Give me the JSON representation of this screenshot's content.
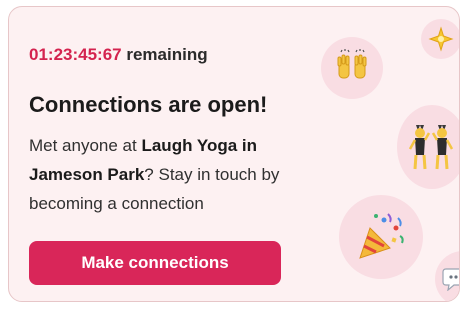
{
  "card": {
    "countdown": {
      "timer": "01:23:45:67",
      "suffix": " remaining"
    },
    "title": "Connections are open!",
    "message": {
      "prefix": "Met anyone at ",
      "place": "Laugh Yoga in Jameson Park",
      "suffix": "? Stay in touch by becoming a connection"
    },
    "cta_label": "Make connections"
  },
  "decorations": {
    "icons": [
      "raising-hands-emoji",
      "sparkle-emoji",
      "dancing-people-emoji",
      "party-popper-emoji",
      "speech-bubble-emoji"
    ]
  },
  "colors": {
    "accent": "#d92659",
    "timer": "#d4234f",
    "card_background": "#fdf1f2",
    "bubble_background": "#f9dde3"
  }
}
